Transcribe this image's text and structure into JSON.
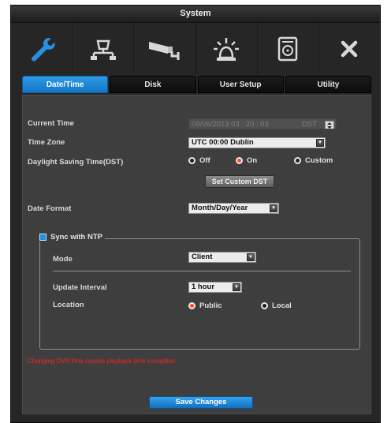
{
  "window": {
    "title": "System"
  },
  "toolbar": {
    "items": [
      {
        "icon": "wrench-icon"
      },
      {
        "icon": "network-icon"
      },
      {
        "icon": "camera-icon"
      },
      {
        "icon": "alarm-icon"
      },
      {
        "icon": "hard-disk-icon"
      },
      {
        "icon": "close-icon"
      }
    ]
  },
  "tabs": [
    {
      "label": "Date/Time",
      "active": true
    },
    {
      "label": "Disk",
      "active": false
    },
    {
      "label": "User Setup",
      "active": false
    },
    {
      "label": "Utility",
      "active": false
    }
  ],
  "form": {
    "current_time": {
      "label": "Current Time",
      "value": "09/06/2013  03 : 20 : 03",
      "dst_label": "DST"
    },
    "time_zone": {
      "label": "Time Zone",
      "value": "UTC 00:00 Dublin"
    },
    "dst": {
      "label": "Daylight Saving Time(DST)",
      "options": [
        {
          "label": "Off",
          "selected": false
        },
        {
          "label": "On",
          "selected": true
        },
        {
          "label": "Custom",
          "selected": false
        }
      ],
      "custom_button": "Set Custom DST"
    },
    "date_format": {
      "label": "Date Format",
      "value": "Month/Day/Year"
    },
    "ntp": {
      "label": "Sync with NTP",
      "checked": true,
      "mode": {
        "label": "Mode",
        "value": "Client"
      },
      "update_interval": {
        "label": "Update Interval",
        "value": "1 hour"
      },
      "location": {
        "label": "Location",
        "options": [
          {
            "label": "Public",
            "selected": true
          },
          {
            "label": "Local",
            "selected": false
          }
        ]
      }
    },
    "warning": "Changing DVR time causes playback time corruption.",
    "save_button": "Save Changes"
  },
  "colors": {
    "accent": "#1a86d6",
    "radio_on": "#ff4b1f",
    "warning": "#ff2222"
  }
}
